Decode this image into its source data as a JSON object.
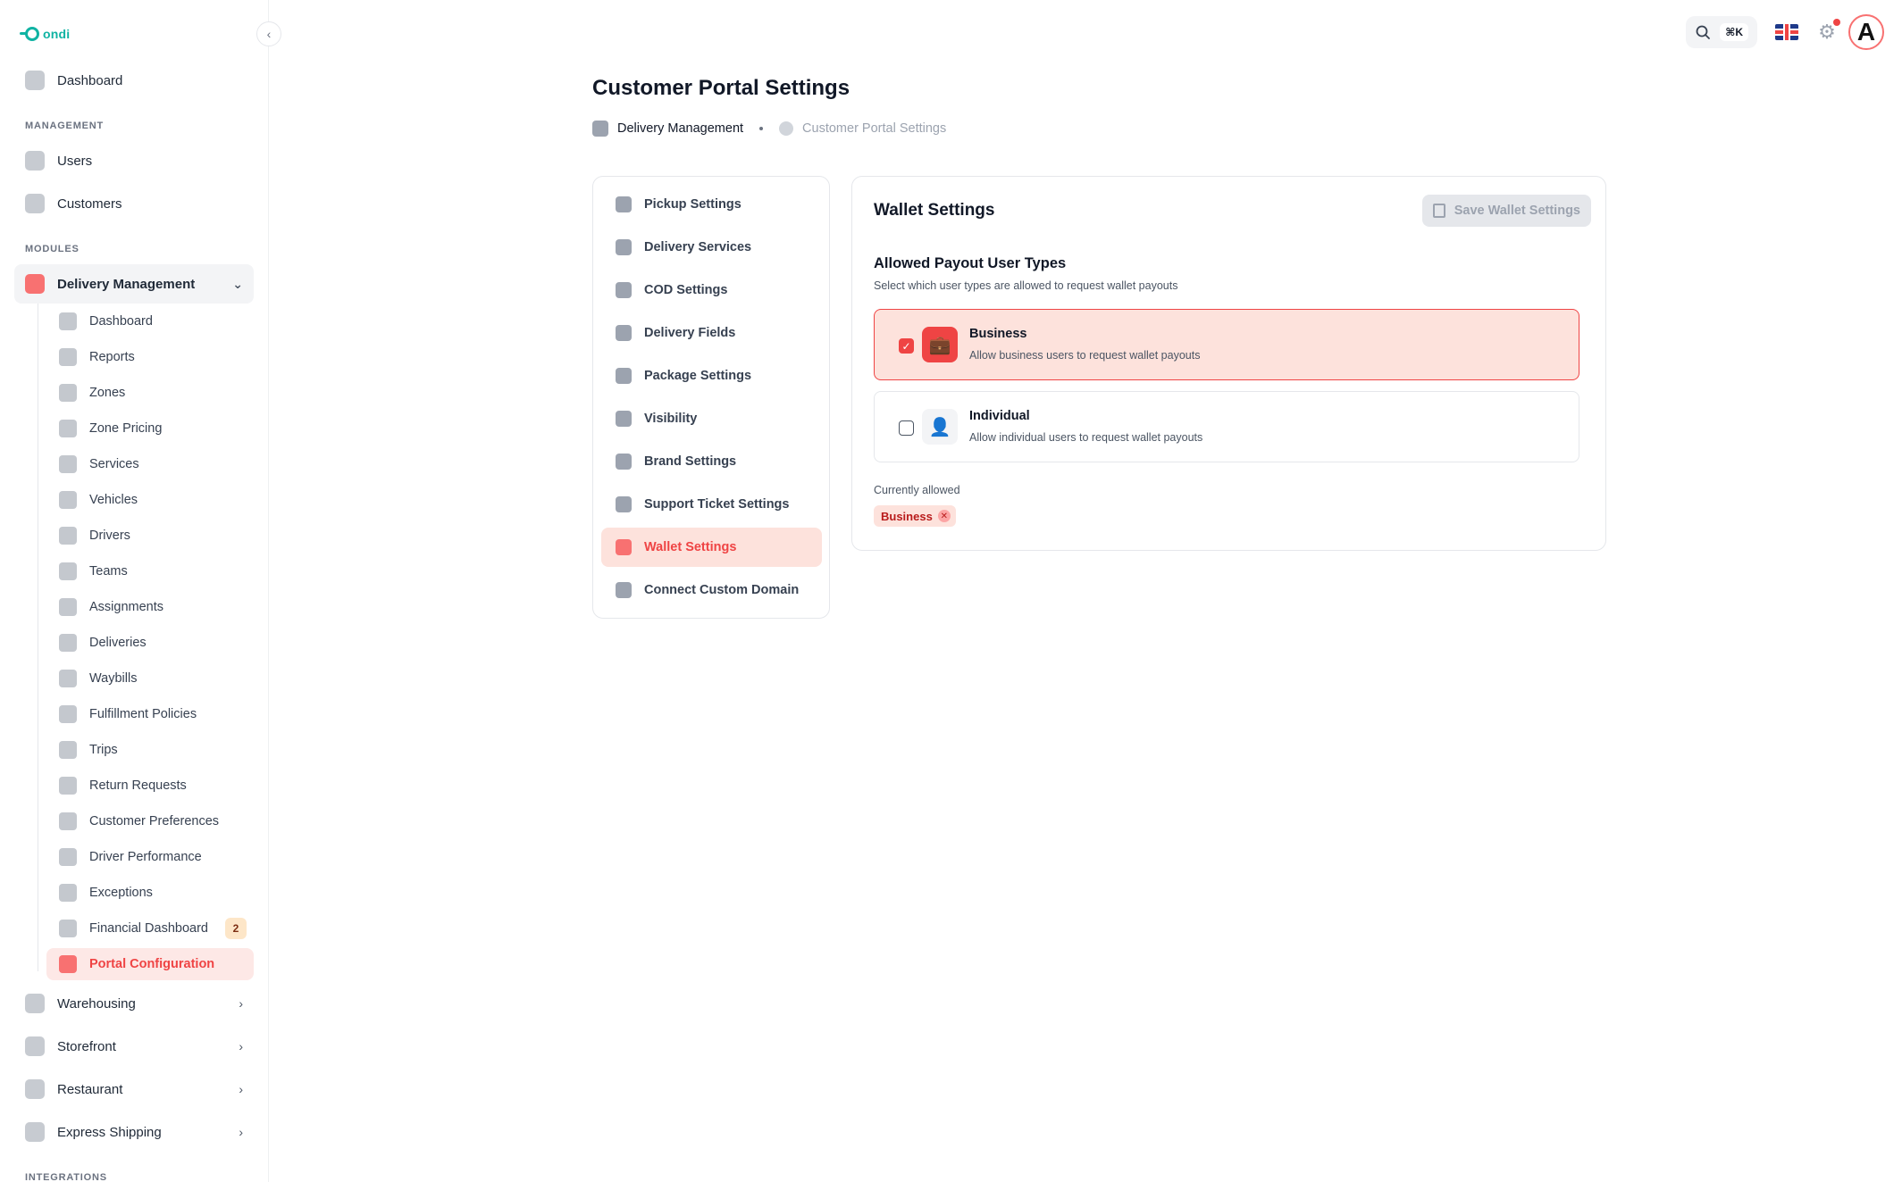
{
  "brand": {
    "logo_text": "ondi",
    "accent": "#ef4444",
    "teal": "#10b3a3"
  },
  "sidebar": {
    "collapse_icon": "chevron-left-icon",
    "top_items": [
      {
        "label": "Dashboard",
        "icon": "gauge-icon"
      }
    ],
    "sections": {
      "management": "MANAGEMENT",
      "modules": "MODULES",
      "integrations": "INTEGRATIONS"
    },
    "management_items": [
      {
        "label": "Users",
        "icon": "user-icon"
      },
      {
        "label": "Customers",
        "icon": "customers-icon"
      }
    ],
    "delivery_management": {
      "label": "Delivery Management",
      "icon": "truck-icon",
      "expanded": true
    },
    "sub_items": [
      {
        "label": "Dashboard",
        "icon": "gauge-icon"
      },
      {
        "label": "Reports",
        "icon": "chart-icon"
      },
      {
        "label": "Zones",
        "icon": "map-pin-icon"
      },
      {
        "label": "Zone Pricing",
        "icon": "dollar-icon"
      },
      {
        "label": "Services",
        "icon": "service-icon"
      },
      {
        "label": "Vehicles",
        "icon": "scooter-icon"
      },
      {
        "label": "Drivers",
        "icon": "id-card-icon"
      },
      {
        "label": "Teams",
        "icon": "team-icon"
      },
      {
        "label": "Assignments",
        "icon": "clipboard-icon"
      },
      {
        "label": "Deliveries",
        "icon": "box-truck-icon"
      },
      {
        "label": "Waybills",
        "icon": "package-check-icon"
      },
      {
        "label": "Fulfillment Policies",
        "icon": "truck-icon"
      },
      {
        "label": "Trips",
        "icon": "truck-fast-icon"
      },
      {
        "label": "Return Requests",
        "icon": "return-icon"
      },
      {
        "label": "Customer Preferences",
        "icon": "sliders-icon"
      },
      {
        "label": "Driver Performance",
        "icon": "speedometer-icon"
      },
      {
        "label": "Exceptions",
        "icon": "warning-icon"
      },
      {
        "label": "Financial Dashboard",
        "icon": "finance-icon",
        "badge": "2"
      },
      {
        "label": "Portal Configuration",
        "icon": "wrench-icon",
        "active": true
      }
    ],
    "module_items": [
      {
        "label": "Warehousing",
        "icon": "warehouse-icon"
      },
      {
        "label": "Storefront",
        "icon": "store-icon"
      },
      {
        "label": "Restaurant",
        "icon": "restaurant-icon"
      },
      {
        "label": "Express Shipping",
        "icon": "shipping-box-icon"
      }
    ]
  },
  "topbar": {
    "shortcut": "⌘K",
    "language": "English (UK)"
  },
  "page": {
    "title": "Customer Portal Settings",
    "breadcrumb": [
      "Delivery Management",
      "Customer Portal Settings"
    ]
  },
  "settings_menu": [
    {
      "label": "Pickup Settings",
      "icon": "pickup-truck-icon"
    },
    {
      "label": "Delivery Services",
      "icon": "globe-truck-icon"
    },
    {
      "label": "COD Settings",
      "icon": "cash-icon"
    },
    {
      "label": "Delivery Fields",
      "icon": "form-fields-icon"
    },
    {
      "label": "Package Settings",
      "icon": "package-icon"
    },
    {
      "label": "Visibility",
      "icon": "eye-icon"
    },
    {
      "label": "Brand Settings",
      "icon": "brush-icon"
    },
    {
      "label": "Support Ticket Settings",
      "icon": "ticket-icon"
    },
    {
      "label": "Wallet Settings",
      "icon": "wallet-icon",
      "active": true
    },
    {
      "label": "Connect Custom Domain",
      "icon": "globe-icon"
    }
  ],
  "wallet": {
    "title": "Wallet Settings",
    "save_label": "Save Wallet Settings",
    "save_enabled": false,
    "section_title": "Allowed Payout User Types",
    "section_desc": "Select which user types are allowed to request wallet payouts",
    "options": [
      {
        "title": "Business",
        "desc": "Allow business users to request wallet payouts",
        "checked": true,
        "icon": "briefcase-icon"
      },
      {
        "title": "Individual",
        "desc": "Allow individual users to request wallet payouts",
        "checked": false,
        "icon": "person-icon"
      }
    ],
    "currently_allowed_label": "Currently allowed",
    "currently_allowed": [
      "Business"
    ]
  }
}
